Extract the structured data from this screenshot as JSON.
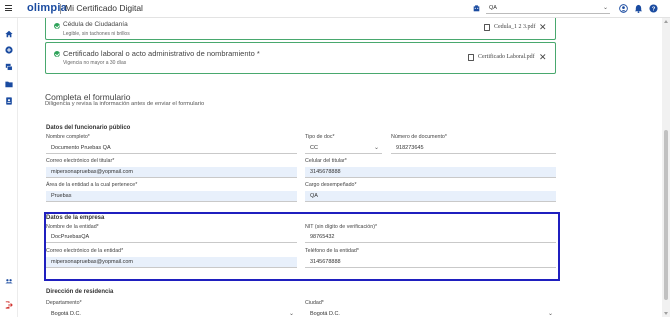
{
  "header": {
    "logo": "olimpia",
    "app_title": "Mi Certificado Digital",
    "org_value": "QA",
    "icons": [
      "menu-icon",
      "building-icon",
      "user-circle-icon",
      "bell-icon",
      "help-icon"
    ]
  },
  "nav": {
    "icons": [
      "home-icon",
      "add-icon",
      "layers-icon",
      "folder-icon",
      "contact-card-icon",
      "users-icon",
      "logout-icon"
    ]
  },
  "documents": [
    {
      "title": "Cédula de Ciudadanía",
      "subtitle": "Legible, sin tachones ni brillos",
      "file": "Cedula_1 2 3.pdf"
    },
    {
      "title": "Certificado laboral o acto administrativo de nombramiento *",
      "subtitle": "Vigencia no mayor a 30 días",
      "file": "Certificado Laboral.pdf"
    }
  ],
  "form": {
    "title": "Completa el formulario",
    "subtitle": "Diligencia y revisa la información antes de enviar el formulario",
    "public_official": {
      "title": "Datos del funcionario público",
      "full_name_label": "Nombre completo*",
      "full_name_value": "Documento Pruebas QA",
      "doc_type_label": "Tipo de doc*",
      "doc_type_value": "CC",
      "doc_number_label": "Número de documento*",
      "doc_number_value": "918273645",
      "email_label": "Correo electrónico del titular*",
      "email_value": "mipersonapruebas@yopmail.com",
      "mobile_label": "Celular del titular*",
      "mobile_value": "3145678888",
      "area_label": "Área de la entidad a la cual pertenece*",
      "area_value": "Pruebas",
      "position_label": "Cargo desempeñado*",
      "position_value": "QA"
    },
    "company": {
      "title": "Datos de la empresa",
      "entity_name_label": "Nombre de la entidad*",
      "entity_name_value": "DocPruebasQA",
      "nit_label": "NIT (sin dígito de verificación)*",
      "nit_value": "98765432",
      "entity_email_label": "Correo electrónico de la entidad*",
      "entity_email_value": "mipersonapruebas@yopmail.com",
      "entity_phone_label": "Teléfono de la entidad*",
      "entity_phone_value": "3145678888"
    },
    "residence": {
      "title": "Dirección de residencia",
      "department_label": "Departamento*",
      "department_value": "Bogotá D.C.",
      "city_label": "Ciudad*",
      "city_value": "Bogotá D.C."
    }
  },
  "colors": {
    "brand": "#1a4ba0",
    "success": "#2fa35a",
    "highlight": "#1f1fbf",
    "filled_input": "#e8f0fb"
  }
}
